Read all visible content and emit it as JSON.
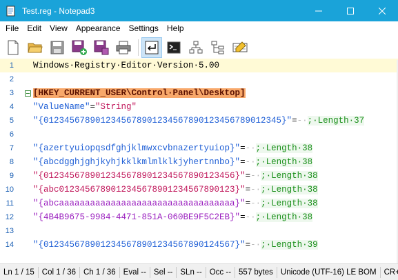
{
  "window": {
    "title": "Test.reg - Notepad3",
    "controls": [
      "minimize-icon",
      "maximize-icon",
      "close-icon"
    ]
  },
  "menu": [
    {
      "id": "file",
      "label": "File"
    },
    {
      "id": "edit",
      "label": "Edit"
    },
    {
      "id": "view",
      "label": "View"
    },
    {
      "id": "appearance",
      "label": "Appearance"
    },
    {
      "id": "settings",
      "label": "Settings"
    },
    {
      "id": "help",
      "label": "Help"
    }
  ],
  "toolbar": {
    "buttons": [
      "new-file-icon",
      "open-folder-icon",
      "save-icon",
      "save-as-icon",
      "save-copy-icon",
      "print-icon",
      "word-wrap-icon",
      "console-icon",
      "network-icon",
      "tree-view-icon",
      "highlighter-icon"
    ],
    "active": "word-wrap-icon"
  },
  "editor": {
    "current_line": 1,
    "lines": [
      {
        "num": "1",
        "parts": [
          {
            "t": "Windows·Registry·Editor·Version·5.00",
            "c": "c-text"
          }
        ]
      },
      {
        "num": "2",
        "parts": []
      },
      {
        "num": "3",
        "fold": true,
        "parts": [
          {
            "t": "[HKEY_CURRENT_USER\\Control·Panel\\Desktop]",
            "c": "c-section"
          }
        ]
      },
      {
        "num": "4",
        "parts": [
          {
            "t": "\"ValueName\"",
            "c": "c-key"
          },
          {
            "t": "=",
            "c": "c-eq"
          },
          {
            "t": "\"String\"",
            "c": "c-str"
          }
        ]
      },
      {
        "num": "5",
        "parts": [
          {
            "t": "\"{0123456789012345678901234567890123456789012345}\"",
            "c": "c-key"
          },
          {
            "t": "=",
            "c": "c-eq"
          },
          {
            "t": "-·",
            "c": "c-dot"
          },
          {
            "t": ";·Length·37",
            "c": "c-comment"
          }
        ]
      },
      {
        "num": "6",
        "parts": []
      },
      {
        "num": "7",
        "parts": [
          {
            "t": "\"{azertyuiopqsdfghjklmwxcvbnazertyuiop}\"",
            "c": "c-key"
          },
          {
            "t": "=",
            "c": "c-eq"
          },
          {
            "t": "-·",
            "c": "c-dot"
          },
          {
            "t": ";·Length·38",
            "c": "c-comment"
          }
        ]
      },
      {
        "num": "8",
        "parts": [
          {
            "t": "\"{abcdgghjghjkyhjkklkmlmlklkjyhertnnbo}\"",
            "c": "c-key"
          },
          {
            "t": "=",
            "c": "c-eq"
          },
          {
            "t": "-·",
            "c": "c-dot"
          },
          {
            "t": ";·Length·38",
            "c": "c-comment"
          }
        ]
      },
      {
        "num": "9",
        "parts": [
          {
            "t": "\"{0123456789012345678901234567890123456}\"",
            "c": "c-str"
          },
          {
            "t": "=",
            "c": "c-eq"
          },
          {
            "t": "-·",
            "c": "c-dot"
          },
          {
            "t": ";·Length·38",
            "c": "c-comment"
          }
        ]
      },
      {
        "num": "10",
        "parts": [
          {
            "t": "\"{abc0123456789012345678901234567890123}\"",
            "c": "c-str"
          },
          {
            "t": "=",
            "c": "c-eq"
          },
          {
            "t": "-·",
            "c": "c-dot"
          },
          {
            "t": ";·Length·38",
            "c": "c-comment"
          }
        ]
      },
      {
        "num": "11",
        "parts": [
          {
            "t": "\"{abcaaaaaaaaaaaaaaaaaaaaaaaaaaaaaaaaaa}\"",
            "c": "c-str2"
          },
          {
            "t": "=",
            "c": "c-eq"
          },
          {
            "t": "-·",
            "c": "c-dot"
          },
          {
            "t": ";·Length·38",
            "c": "c-comment"
          }
        ]
      },
      {
        "num": "12",
        "parts": [
          {
            "t": "\"{4B4B9675-9984-4471-851A-060BE9F5C2EB}\"",
            "c": "c-str2"
          },
          {
            "t": "=",
            "c": "c-eq"
          },
          {
            "t": "-·",
            "c": "c-dot"
          },
          {
            "t": ";·Length·38",
            "c": "c-comment"
          }
        ]
      },
      {
        "num": "13",
        "parts": []
      },
      {
        "num": "14",
        "parts": [
          {
            "t": "\"{0123456789012345678901234567890124567}\"",
            "c": "c-key"
          },
          {
            "t": "=",
            "c": "c-eq"
          },
          {
            "t": "-·",
            "c": "c-dot"
          },
          {
            "t": ";·Length·39",
            "c": "c-comment"
          }
        ]
      }
    ]
  },
  "statusbar": {
    "line": "Ln  1 / 15",
    "col": "Col  1 / 36",
    "ch": "Ch  1 / 36",
    "eval": "Eval  --",
    "sel": "Sel  --",
    "sln": "SLn  --",
    "occ": "Occ  --",
    "size": "557 bytes",
    "encoding": "Unicode (UTF-16) LE BOM",
    "eol": "CR+LF"
  },
  "colors": {
    "titlebar": "#1aa3d9",
    "current_line": "#fffad6",
    "section_bg": "#f8a86a",
    "line_number": "#1a5fb4"
  }
}
